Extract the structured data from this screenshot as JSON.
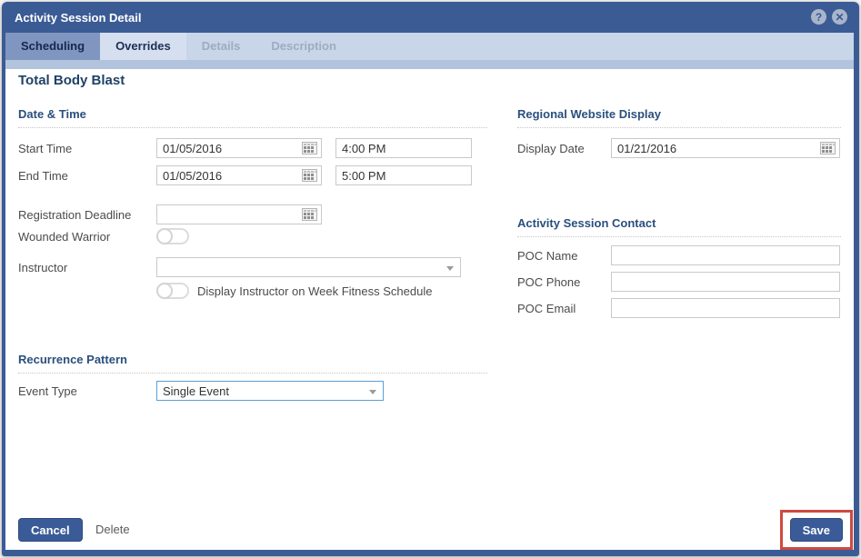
{
  "window": {
    "title": "Activity Session Detail"
  },
  "icons": {
    "help_glyph": "?",
    "close_glyph": "✕",
    "calendar": "calendar-grid",
    "dropdown_arrow": "chevron-down"
  },
  "tabs": [
    {
      "label": "Scheduling",
      "state": "active"
    },
    {
      "label": "Overrides",
      "state": "normal"
    },
    {
      "label": "Details",
      "state": "disabled"
    },
    {
      "label": "Description",
      "state": "disabled"
    }
  ],
  "page": {
    "heading": "Total Body Blast"
  },
  "date_time": {
    "header": "Date & Time",
    "start_label": "Start Time",
    "start_date": "01/05/2016",
    "start_time": "4:00 PM",
    "end_label": "End Time",
    "end_date": "01/05/2016",
    "end_time": "5:00 PM",
    "registration_label": "Registration Deadline",
    "registration_date": "",
    "wounded_warrior_label": "Wounded Warrior",
    "wounded_warrior_state": "off",
    "instructor_label": "Instructor",
    "instructor_value": "",
    "display_instructor_label": "Display Instructor on Week Fitness Schedule",
    "display_instructor_state": "off"
  },
  "regional": {
    "header": "Regional Website Display",
    "display_date_label": "Display Date",
    "display_date": "01/21/2016"
  },
  "contact": {
    "header": "Activity Session Contact",
    "poc_name_label": "POC Name",
    "poc_name": "",
    "poc_phone_label": "POC Phone",
    "poc_phone": "",
    "poc_email_label": "POC Email",
    "poc_email": ""
  },
  "recurrence": {
    "header": "Recurrence Pattern",
    "event_type_label": "Event Type",
    "event_type_value": "Single Event"
  },
  "footer": {
    "cancel_label": "Cancel",
    "delete_label": "Delete",
    "save_label": "Save"
  },
  "colors": {
    "titlebar_blue": "#3b5b95",
    "tabbar_light_blue": "#c9d5e9",
    "active_tab_blue": "#8096c0",
    "tab_strip_blue": "#b2c4dd",
    "button_blue": "#3a5b97",
    "section_header_blue": "#2a4f7d",
    "highlight_red": "#cf4a3f",
    "event_select_border": "#58a0d7"
  }
}
